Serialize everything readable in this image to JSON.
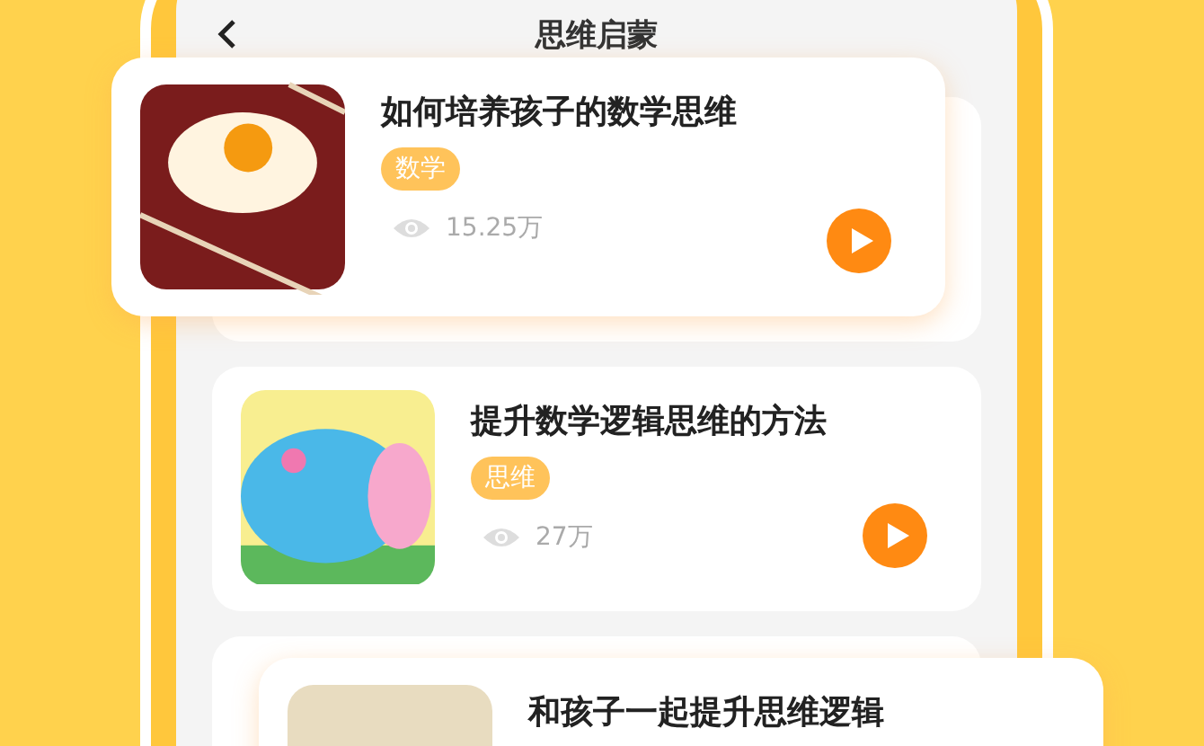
{
  "header": {
    "title": "思维启蒙"
  },
  "cards": [
    {
      "kind": "popped",
      "image": {
        "kind": "egg"
      },
      "title": "如何培养孩子的数学思维",
      "tag": "数学",
      "views": "15.25万"
    },
    {
      "kind": "normal",
      "image": {
        "kind": "bear"
      },
      "title": "提升数学逻辑思维的方法",
      "tag": "思维",
      "views": "27万"
    },
    {
      "kind": "popped",
      "image": {
        "kind": "plain"
      },
      "title": "和孩子一起提升思维逻辑"
    }
  ]
}
